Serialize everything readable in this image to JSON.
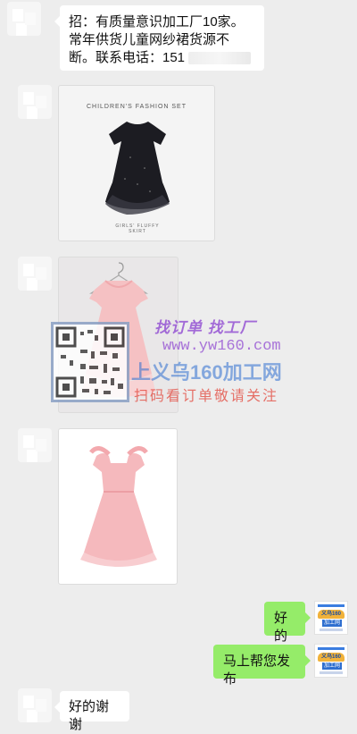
{
  "messages": {
    "recruit_text": "招：有质量意识加工厂10家。常年供货儿童网纱裙货源不断。联系电话：151",
    "reply_ok": "好的",
    "reply_publish": "马上帮您发布",
    "thanks": "好的谢谢"
  },
  "image1": {
    "header": "CHILDREN'S FASHION SET",
    "caption": "GIRLS' FLUFFY SKIRT"
  },
  "watermark": {
    "line1": "找订单 找工厂",
    "line2": "www.yw160.com",
    "line3": "上义乌160加工网",
    "line4": "扫码看订单敬请关注"
  },
  "logo_avatar": {
    "top": "义乌160",
    "bottom": "加工网"
  },
  "colors": {
    "background": "#ededed",
    "bubble_self": "#95ec69",
    "bubble_other": "#ffffff",
    "watermark_purple": "#8a3fd0",
    "watermark_red": "#e23a2e",
    "watermark_blue": "#2f6fd0"
  }
}
